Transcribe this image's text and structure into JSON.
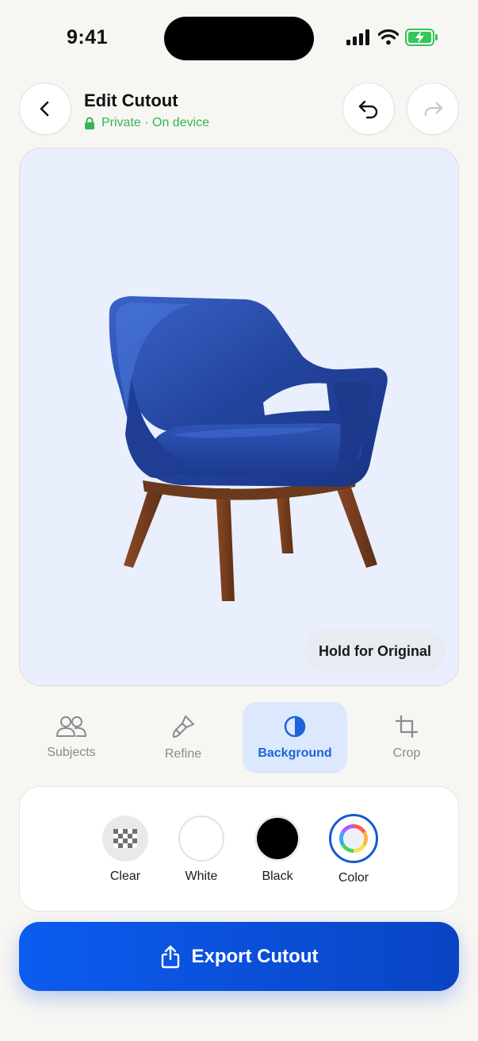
{
  "status_bar": {
    "time": "9:41",
    "battery_color": "#34c759"
  },
  "header": {
    "title": "Edit Cutout",
    "privacy_text": "Private · On device",
    "privacy_color": "#34b553"
  },
  "canvas": {
    "background_color": "#e9effc",
    "hold_label": "Hold for Original"
  },
  "tabs": [
    {
      "label": "Subjects",
      "icon": "people-icon",
      "active": false
    },
    {
      "label": "Refine",
      "icon": "brush-icon",
      "active": false
    },
    {
      "label": "Background",
      "icon": "half-circle-icon",
      "active": true
    },
    {
      "label": "Crop",
      "icon": "crop-icon",
      "active": false
    }
  ],
  "background_options": [
    {
      "label": "Clear",
      "icon": "checkerboard-icon",
      "selected": false
    },
    {
      "label": "White",
      "color": "#ffffff",
      "selected": false
    },
    {
      "label": "Black",
      "color": "#000000",
      "selected": false
    },
    {
      "label": "Color",
      "icon": "color-wheel-icon",
      "selected": true
    }
  ],
  "export": {
    "label": "Export Cutout",
    "icon": "share-icon"
  },
  "accent_color": "#1f63d8"
}
